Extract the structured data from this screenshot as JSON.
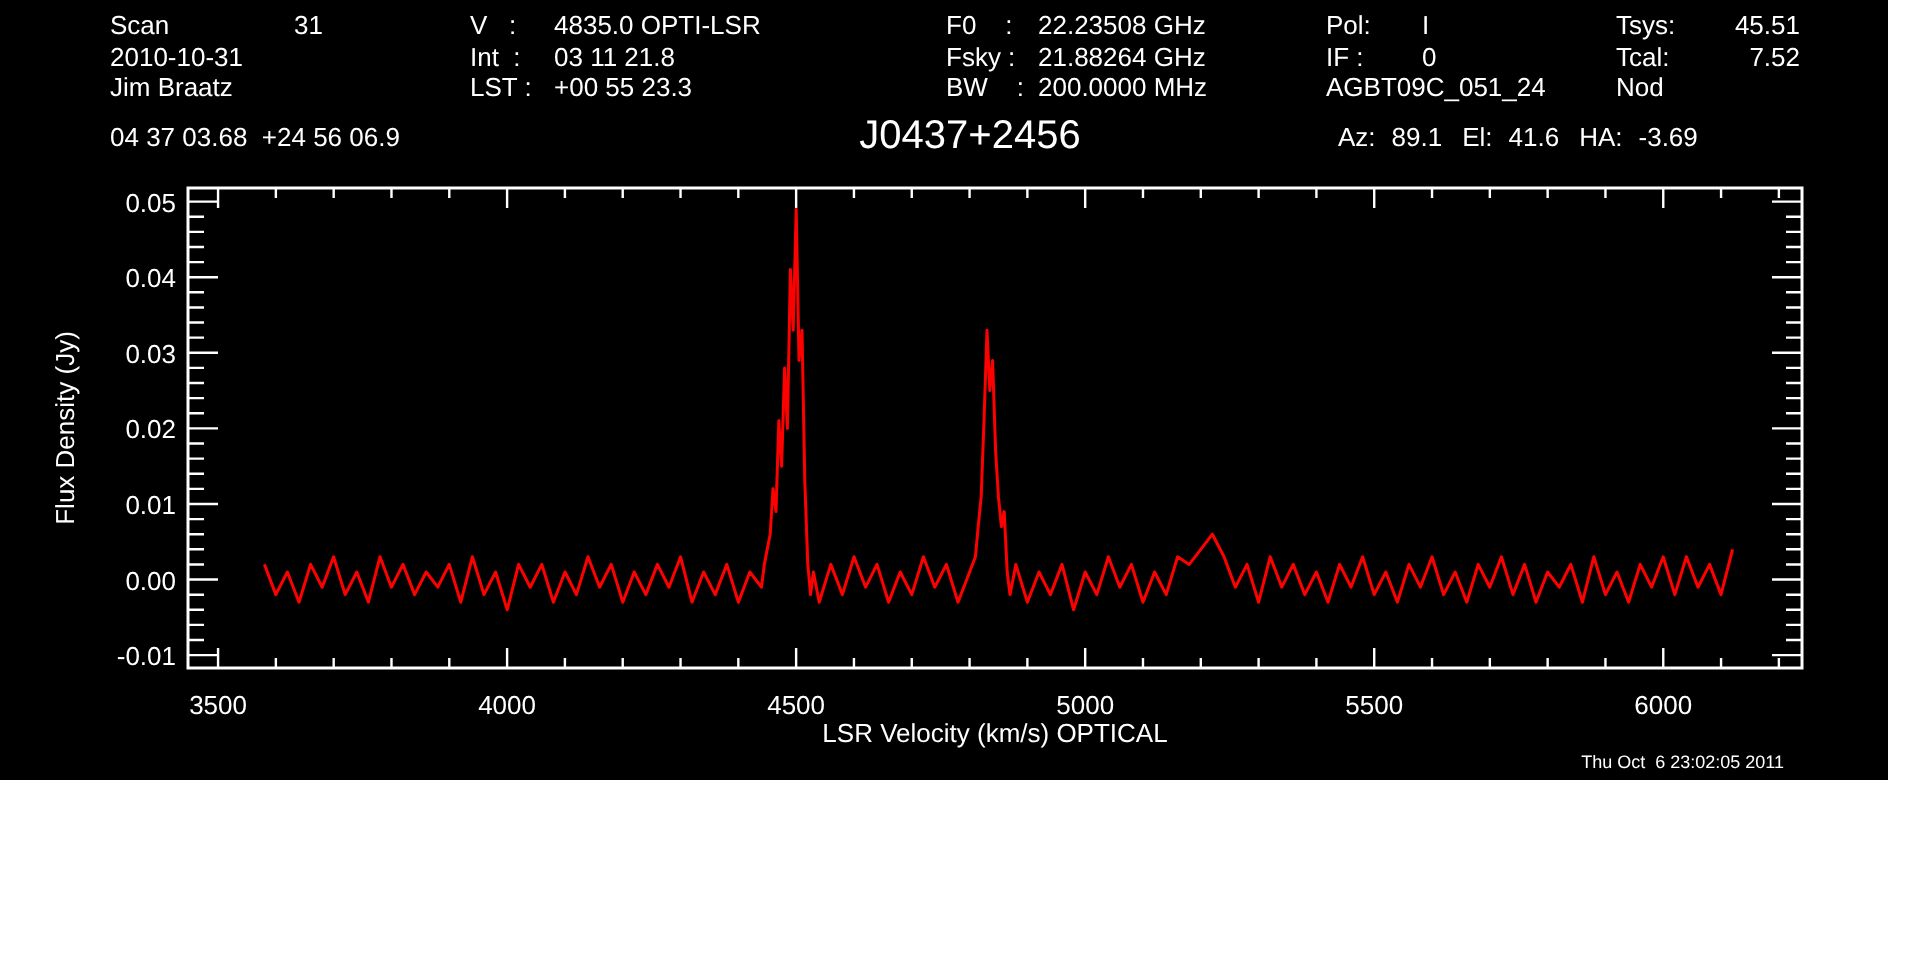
{
  "header": {
    "columns": [
      [
        {
          "label": "Scan",
          "value": "31"
        },
        {
          "label": "2010-10-31"
        },
        {
          "label": "Jim Braatz"
        }
      ],
      [
        {
          "label": "V   :",
          "value": "4835.0 OPTI-LSR"
        },
        {
          "label": "Int  :",
          "value": "03 11 21.8"
        },
        {
          "label": "LST :",
          "value": "+00 55 23.3"
        }
      ],
      [
        {
          "label": "F0    :",
          "value": "22.23508 GHz"
        },
        {
          "label": "Fsky :",
          "value": "21.88264 GHz"
        },
        {
          "label": "BW    :",
          "value": "200.0000 MHz"
        }
      ],
      [
        {
          "label": "Pol:",
          "value": "I"
        },
        {
          "label": "IF :",
          "value": "0"
        },
        {
          "label": "AGBT09C_051_24"
        }
      ],
      [
        {
          "label": "Tsys:",
          "value": "45.51"
        },
        {
          "label": "Tcal:",
          "value": "7.52"
        },
        {
          "label": "Nod"
        }
      ]
    ],
    "coordinates": "04 37 03.68  +24 56 06.9",
    "source": "J0437+2456",
    "pointing": [
      {
        "label": "Az:",
        "value": "89.1"
      },
      {
        "label": "El:",
        "value": "41.6"
      },
      {
        "label": "HA:",
        "value": "-3.69"
      }
    ]
  },
  "chart_data": {
    "type": "line",
    "xlabel": "LSR Velocity (km/s) OPTICAL",
    "ylabel": "Flux Density (Jy)",
    "xlim": [
      3448,
      6240
    ],
    "ylim": [
      -0.0117,
      0.0518
    ],
    "xticks": [
      3500,
      4000,
      4500,
      5000,
      5500,
      6000
    ],
    "yticks": [
      {
        "value": -0.01,
        "label": "-0.01"
      },
      {
        "value": 0,
        "label": "0.00"
      },
      {
        "value": 0.01,
        "label": "0.01"
      },
      {
        "value": 0.02,
        "label": "0.02"
      },
      {
        "value": 0.03,
        "label": "0.03"
      },
      {
        "value": 0.04,
        "label": "0.04"
      },
      {
        "value": 0.05,
        "label": "0.05"
      }
    ],
    "x": [
      3580,
      3600,
      3620,
      3640,
      3660,
      3680,
      3700,
      3720,
      3740,
      3760,
      3780,
      3800,
      3820,
      3840,
      3860,
      3880,
      3900,
      3920,
      3940,
      3960,
      3980,
      4000,
      4020,
      4040,
      4060,
      4080,
      4100,
      4120,
      4140,
      4160,
      4180,
      4200,
      4220,
      4240,
      4260,
      4280,
      4300,
      4320,
      4340,
      4360,
      4380,
      4400,
      4420,
      4440,
      4445,
      4450,
      4455,
      4460,
      4465,
      4470,
      4475,
      4480,
      4485,
      4490,
      4495,
      4500,
      4505,
      4510,
      4515,
      4520,
      4525,
      4530,
      4540,
      4560,
      4580,
      4600,
      4620,
      4640,
      4660,
      4680,
      4700,
      4720,
      4740,
      4760,
      4780,
      4800,
      4810,
      4815,
      4820,
      4825,
      4830,
      4835,
      4840,
      4845,
      4850,
      4855,
      4860,
      4865,
      4870,
      4875,
      4880,
      4900,
      4920,
      4940,
      4960,
      4980,
      5000,
      5020,
      5040,
      5060,
      5080,
      5100,
      5120,
      5140,
      5160,
      5180,
      5200,
      5220,
      5240,
      5260,
      5280,
      5300,
      5320,
      5340,
      5360,
      5380,
      5400,
      5420,
      5440,
      5460,
      5480,
      5500,
      5520,
      5540,
      5560,
      5580,
      5600,
      5620,
      5640,
      5660,
      5680,
      5700,
      5720,
      5740,
      5760,
      5780,
      5800,
      5820,
      5840,
      5860,
      5880,
      5900,
      5920,
      5940,
      5960,
      5980,
      6000,
      6020,
      6040,
      6060,
      6080,
      6100,
      6120
    ],
    "series": [
      {
        "color": "#ff0000",
        "values": [
          0.002,
          -0.002,
          0.001,
          -0.003,
          0.002,
          -0.001,
          0.003,
          -0.002,
          0.001,
          -0.003,
          0.003,
          -0.001,
          0.002,
          -0.002,
          0.001,
          -0.001,
          0.002,
          -0.003,
          0.003,
          -0.002,
          0.001,
          -0.004,
          0.002,
          -0.001,
          0.002,
          -0.003,
          0.001,
          -0.002,
          0.003,
          -0.001,
          0.002,
          -0.003,
          0.001,
          -0.002,
          0.002,
          -0.001,
          0.003,
          -0.003,
          0.001,
          -0.002,
          0.002,
          -0.003,
          0.001,
          -0.001,
          0.002,
          0.004,
          0.006,
          0.012,
          0.009,
          0.021,
          0.015,
          0.028,
          0.02,
          0.041,
          0.033,
          0.049,
          0.029,
          0.033,
          0.013,
          0.002,
          -0.002,
          0.001,
          -0.003,
          0.002,
          -0.002,
          0.003,
          -0.001,
          0.002,
          -0.003,
          0.001,
          -0.002,
          0.003,
          -0.001,
          0.002,
          -0.003,
          0.001,
          0.003,
          0.007,
          0.011,
          0.021,
          0.033,
          0.025,
          0.029,
          0.017,
          0.011,
          0.007,
          0.009,
          0.001,
          -0.002,
          0.0,
          0.002,
          -0.003,
          0.001,
          -0.002,
          0.002,
          -0.004,
          0.001,
          -0.002,
          0.003,
          -0.001,
          0.002,
          -0.003,
          0.001,
          -0.002,
          0.003,
          0.002,
          0.004,
          0.006,
          0.003,
          -0.001,
          0.002,
          -0.003,
          0.003,
          -0.001,
          0.002,
          -0.002,
          0.001,
          -0.003,
          0.002,
          -0.001,
          0.003,
          -0.002,
          0.001,
          -0.003,
          0.002,
          -0.001,
          0.003,
          -0.002,
          0.001,
          -0.003,
          0.002,
          -0.001,
          0.003,
          -0.002,
          0.002,
          -0.003,
          0.001,
          -0.001,
          0.002,
          -0.003,
          0.003,
          -0.002,
          0.001,
          -0.003,
          0.002,
          -0.001,
          0.003,
          -0.002,
          0.003,
          -0.001,
          0.002,
          -0.002,
          0.004
        ]
      }
    ]
  },
  "timestamp": "Thu Oct  6 23:02:05 2011"
}
